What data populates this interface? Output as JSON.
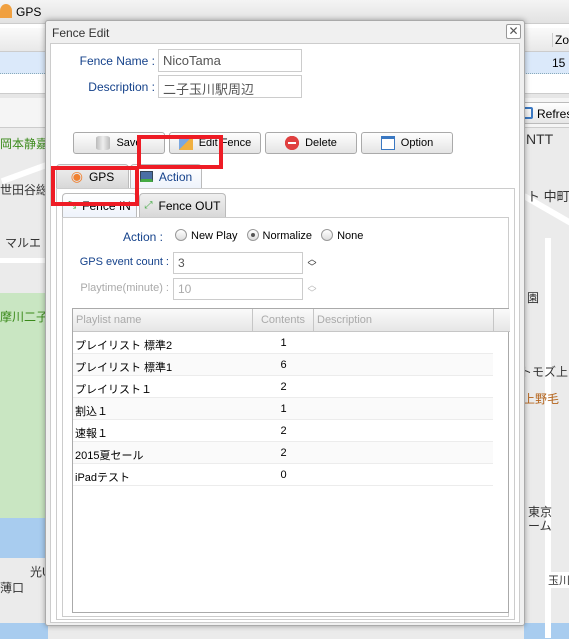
{
  "app": {
    "title": "GPS",
    "grid_header_partial": "Zo",
    "grid_selected_value": "15",
    "refresh_label": "Refres"
  },
  "map_labels": [
    "岡本静嘉",
    "世田谷総合",
    "マルエ",
    "摩川二子",
    "NTT",
    "ト 中町",
    "園",
    "トモズ上",
    "上野毛",
    "東京",
    "ーム",
    "光U",
    "薄口",
    "玉川"
  ],
  "dialog": {
    "title": "Fence Edit",
    "fence_name_label": "Fence Name :",
    "fence_name": "NicoTama",
    "description_label": "Description :",
    "description": "二子玉川駅周辺",
    "buttons": [
      {
        "label": "Save",
        "icon": "database-icon"
      },
      {
        "label": "Edit Fence",
        "icon": "pencil-icon"
      },
      {
        "label": "Delete",
        "icon": "delete-icon"
      },
      {
        "label": "Option",
        "icon": "window-icon"
      }
    ],
    "tabs": [
      {
        "label": "GPS",
        "icon": "gps-signal-icon",
        "active": false
      },
      {
        "label": "Action",
        "icon": "monitor-arrow-icon",
        "active": true
      }
    ],
    "subtabs": [
      {
        "label": "Fence IN",
        "active": true
      },
      {
        "label": "Fence OUT",
        "active": false
      }
    ],
    "action_label": "Action :",
    "action_options": [
      {
        "label": "New Play",
        "checked": false
      },
      {
        "label": "Normalize",
        "checked": true
      },
      {
        "label": "None",
        "checked": false
      }
    ],
    "gps_count_label": "GPS event count :",
    "gps_count": "3",
    "playtime_label": "Playtime(minute) :",
    "playtime": "10",
    "columns": [
      "Playlist name",
      "Contents",
      "Description"
    ],
    "rows": [
      [
        "プレイリスト 標準2",
        "1",
        ""
      ],
      [
        "プレイリスト 標準1",
        "6",
        ""
      ],
      [
        "プレイリスト１",
        "2",
        ""
      ],
      [
        "割込１",
        "1",
        ""
      ],
      [
        "速報１",
        "2",
        ""
      ],
      [
        "2015夏セール",
        "2",
        ""
      ],
      [
        "iPadテスト",
        "0",
        ""
      ]
    ],
    "highlight_color": "#ee1c25"
  }
}
